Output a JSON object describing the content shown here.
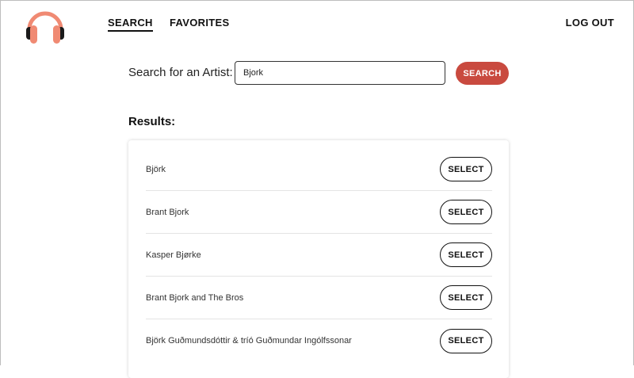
{
  "header": {
    "logo_icon": "headphones-icon",
    "nav": {
      "search_label": "SEARCH",
      "favorites_label": "FAVORITES",
      "logout_label": "LOG OUT"
    }
  },
  "search": {
    "label": "Search for an Artist:",
    "value": "Bjork",
    "button_label": "SEARCH"
  },
  "results": {
    "heading": "Results:",
    "items": [
      {
        "name": "Björk",
        "button_label": "SELECT"
      },
      {
        "name": "Brant Bjork",
        "button_label": "SELECT"
      },
      {
        "name": "Kasper Bjørke",
        "button_label": "SELECT"
      },
      {
        "name": "Brant Bjork and The Bros",
        "button_label": "SELECT"
      },
      {
        "name": "Björk Guðmundsdóttir & tríó Guðmundar Ingólfssonar",
        "button_label": "SELECT"
      }
    ]
  },
  "colors": {
    "accent": "#c94a3f",
    "logo_band": "#f08a73",
    "logo_cups": "#1a1a1a",
    "logo_pads": "#f08a73"
  }
}
